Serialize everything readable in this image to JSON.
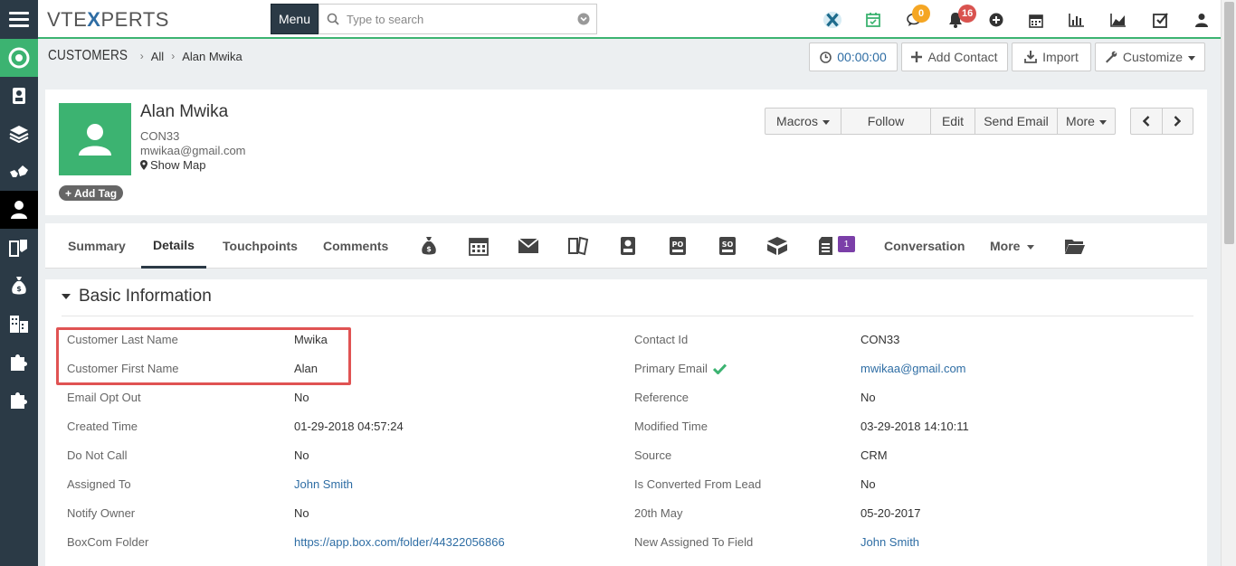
{
  "topbar": {
    "logo_prefix": "VTE",
    "logo_x": "X",
    "logo_suffix": "PERTS",
    "menu_label": "Menu",
    "search_placeholder": "Type to search",
    "chat_badge": "0",
    "notification_badge": "16",
    "chat_badge_color": "#f5a623",
    "notification_badge_color": "#d9534f"
  },
  "sidebar": {
    "items": [
      "dashboard-icon",
      "contacts-book-icon",
      "layers-icon",
      "handshake-icon",
      "user-icon",
      "tag-icon",
      "money-bag-icon",
      "building-icon",
      "puzzle-icon",
      "puzzle-icon"
    ],
    "active_index": 4,
    "accent": "#3cb371"
  },
  "breadcrumb": {
    "module": "Customers",
    "filter": "All",
    "record": "Alan Mwika"
  },
  "header_buttons": {
    "timer": "00:00:00",
    "add_contact": "Add Contact",
    "import": "Import",
    "customize": "Customize"
  },
  "record": {
    "name": "Alan Mwika",
    "id": "CON33",
    "email": "mwikaa@gmail.com",
    "show_map": "Show Map",
    "add_tag": "Add Tag"
  },
  "actions": {
    "macros": "Macros",
    "follow": "Follow",
    "edit": "Edit",
    "send_email": "Send Email",
    "more": "More"
  },
  "tabs": {
    "summary": "Summary",
    "details": "Details",
    "touchpoints": "Touchpoints",
    "comments": "Comments",
    "docs_badge": "1",
    "conversation": "Conversation",
    "more": "More",
    "icons": [
      "money-bag-icon",
      "calendar-icon",
      "email-icon",
      "tickets-icon",
      "contacts-book-icon",
      "purchase-order-icon",
      "sales-order-icon",
      "products-icon",
      "documents-icon",
      "folder-icon"
    ]
  },
  "section": {
    "title": "Basic Information",
    "left_fields": [
      {
        "label": "Customer Last Name",
        "value": "Mwika"
      },
      {
        "label": "Customer First Name",
        "value": "Alan"
      },
      {
        "label": "Email Opt Out",
        "value": "No"
      },
      {
        "label": "Created Time",
        "value": "01-29-2018 04:57:24"
      },
      {
        "label": "Do Not Call",
        "value": "No"
      },
      {
        "label": "Assigned To",
        "value": "John Smith"
      },
      {
        "label": "Notify Owner",
        "value": "No"
      },
      {
        "label": "BoxCom Folder",
        "value": "https://app.box.com/folder/44322056866"
      }
    ],
    "right_fields": [
      {
        "label": "Contact Id",
        "value": "CON33"
      },
      {
        "label": "Primary Email",
        "value": "mwikaa@gmail.com"
      },
      {
        "label": "Reference",
        "value": "No"
      },
      {
        "label": "Modified Time",
        "value": "03-29-2018 14:10:11"
      },
      {
        "label": "Source",
        "value": "CRM"
      },
      {
        "label": "Is Converted From Lead",
        "value": "No"
      },
      {
        "label": "20th May",
        "value": "05-20-2017"
      },
      {
        "label": "New Assigned To Field",
        "value": "John Smith"
      }
    ],
    "highlight_color": "#e05353"
  }
}
